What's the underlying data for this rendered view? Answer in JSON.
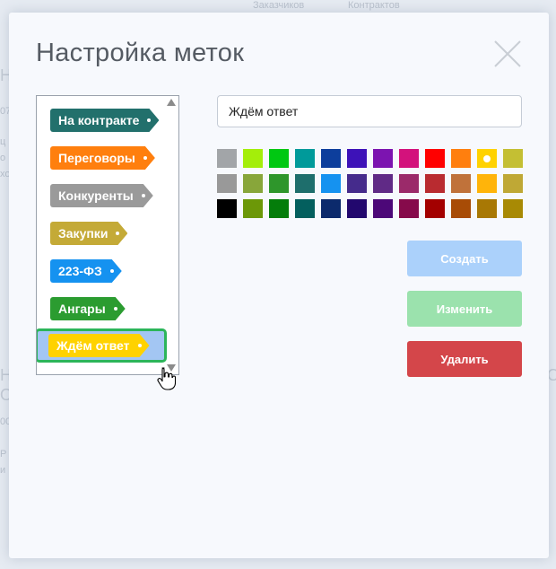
{
  "background": {
    "tabs": [
      "Заказчиков",
      "Контрактов"
    ],
    "left_fragments": [
      "Н",
      "07",
      "ц",
      "о",
      "хо",
      "Н",
      "О",
      "00",
      "Р",
      "и"
    ],
    "right_fragments": [
      "О"
    ]
  },
  "dialog": {
    "title": "Настройка меток",
    "close_icon": "close-icon"
  },
  "tags": [
    {
      "label": "На контракте",
      "color": "#22706c"
    },
    {
      "label": "Переговоры",
      "color": "#ff7f0e"
    },
    {
      "label": "Конкуренты",
      "color": "#9a9a9a"
    },
    {
      "label": "Закупки",
      "color": "#c4aa37"
    },
    {
      "label": "223-ФЗ",
      "color": "#1592f0"
    },
    {
      "label": "Ангары",
      "color": "#2b9c30"
    },
    {
      "label": "Ждём ответ",
      "color": "#ffd200",
      "selected": true
    }
  ],
  "editor": {
    "name_value": "Ждём ответ",
    "palette": [
      [
        "#a2a5a8",
        "#a4ee0a",
        "#00c812",
        "#009a9a",
        "#0d3e9c",
        "#3d12b8",
        "#7c14b0",
        "#d3127c",
        "#ff0000",
        "#ff7f0e",
        "#ffd200",
        "#c4bf33"
      ],
      [
        "#999999",
        "#88a63a",
        "#2e962b",
        "#1e6e6c",
        "#1592f0",
        "#452b8c",
        "#602a86",
        "#9b2a6a",
        "#b92b30",
        "#c0723a",
        "#ffb40a",
        "#bfa835"
      ],
      [
        "#000000",
        "#6c9808",
        "#047d0a",
        "#035f5e",
        "#0c2a6c",
        "#22086e",
        "#4c0878",
        "#860a4b",
        "#a30000",
        "#a84c06",
        "#a87804",
        "#a88a04"
      ]
    ],
    "selected_color": "#ffd200"
  },
  "buttons": {
    "create": "Создать",
    "edit": "Изменить",
    "delete": "Удалить"
  }
}
